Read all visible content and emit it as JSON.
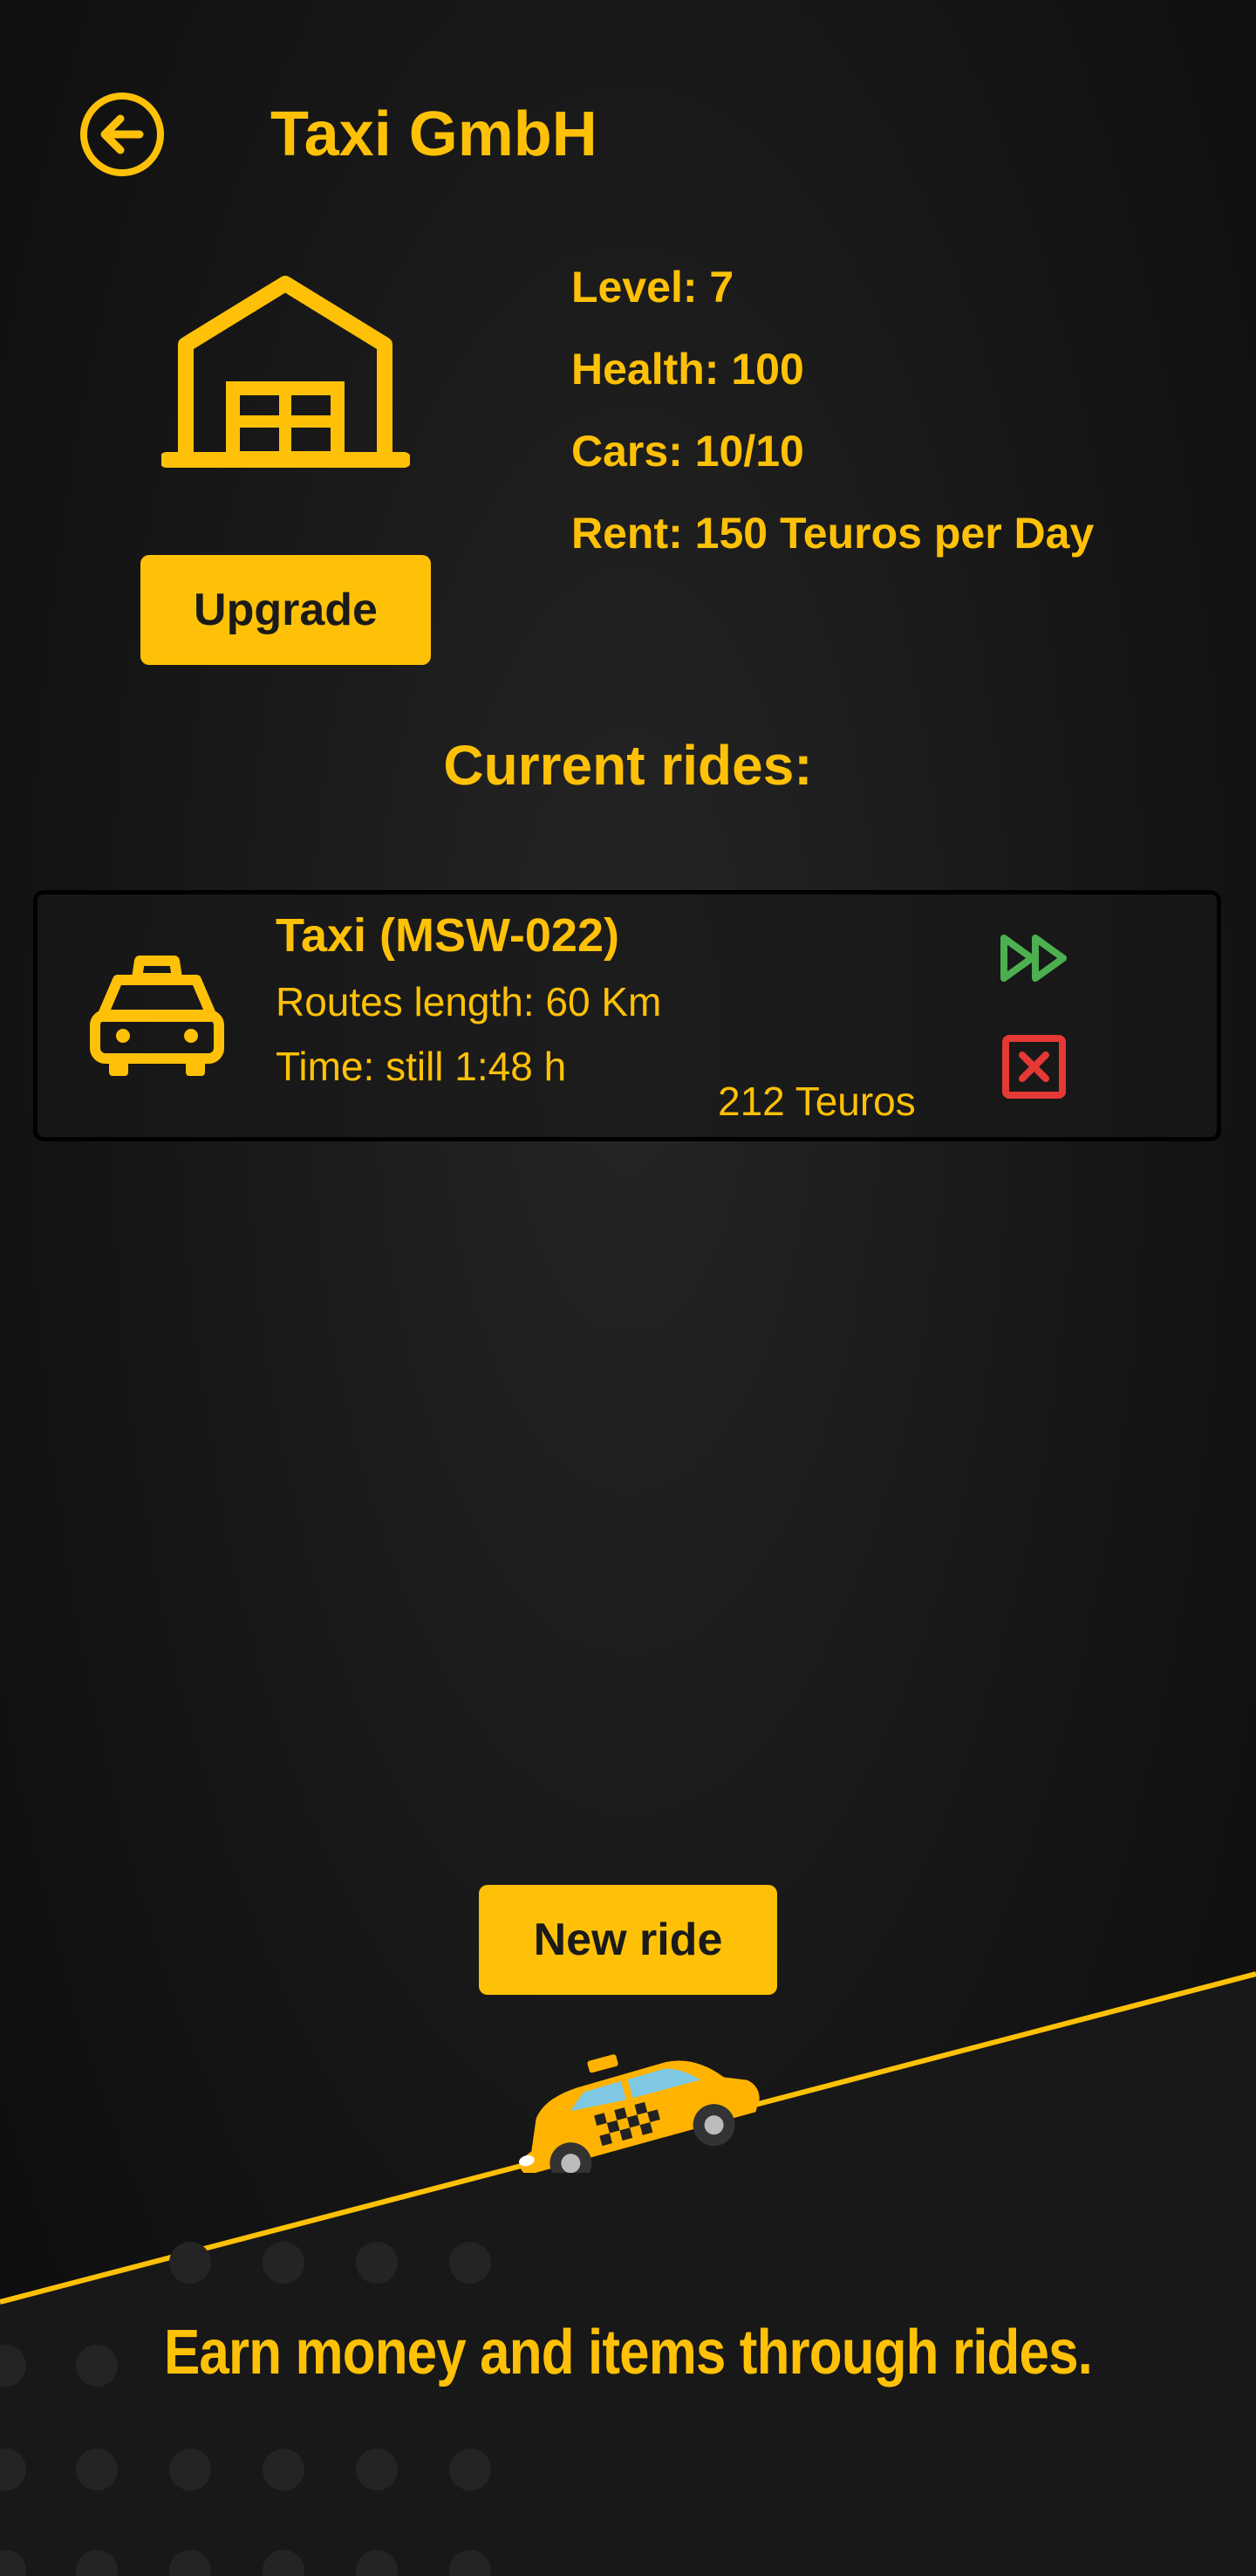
{
  "header": {
    "title": "Taxi GmbH",
    "back_icon": "arrow-left-circle-icon"
  },
  "garage": {
    "icon": "warehouse-icon",
    "upgrade_label": "Upgrade",
    "stats": {
      "level": "Level: 7",
      "health": "Health: 100",
      "cars": "Cars: 10/10",
      "rent": "Rent: 150 Teuros per Day"
    }
  },
  "rides": {
    "heading": "Current rides:",
    "items": [
      {
        "icon": "taxi-icon",
        "name": "Taxi (MSW-022)",
        "route": "Routes length: 60 Km",
        "time": "Time: still 1:48 h",
        "reward": "212 Teuros",
        "fast_forward_icon": "fast-forward-icon",
        "cancel_icon": "cancel-box-icon"
      }
    ]
  },
  "new_ride_label": "New ride",
  "footer": {
    "tagline": "Earn money and items through rides."
  },
  "colors": {
    "accent": "#FFC107",
    "fast_forward": "#4CAF50",
    "cancel": "#E53935",
    "background": "#161616"
  }
}
